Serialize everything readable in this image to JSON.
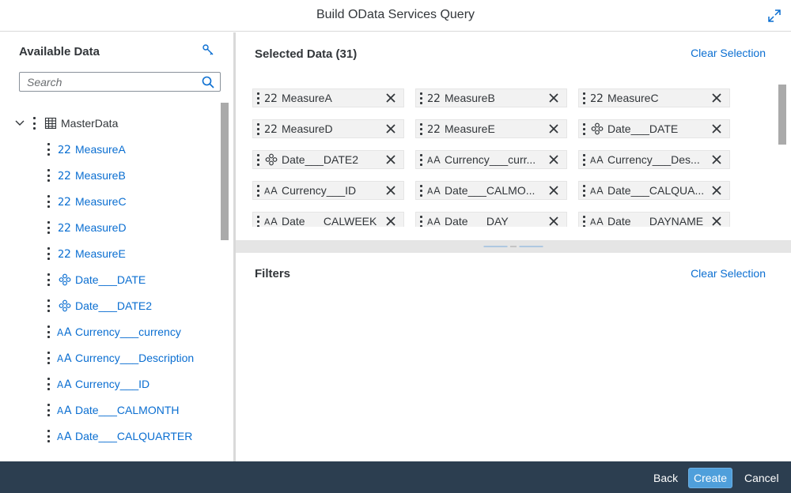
{
  "dialog": {
    "title": "Build OData Services Query"
  },
  "available": {
    "title": "Available Data",
    "search_placeholder": "Search",
    "root": {
      "label": "MasterData",
      "icon": "table-icon"
    },
    "items": [
      {
        "label": "MeasureA",
        "icon": "measure-icon"
      },
      {
        "label": "MeasureB",
        "icon": "measure-icon"
      },
      {
        "label": "MeasureC",
        "icon": "measure-icon"
      },
      {
        "label": "MeasureD",
        "icon": "measure-icon"
      },
      {
        "label": "MeasureE",
        "icon": "measure-icon"
      },
      {
        "label": "Date___DATE",
        "icon": "hierarchy-icon"
      },
      {
        "label": "Date___DATE2",
        "icon": "hierarchy-icon"
      },
      {
        "label": "Currency___currency",
        "icon": "text-dimension-icon"
      },
      {
        "label": "Currency___Description",
        "icon": "text-dimension-icon"
      },
      {
        "label": "Currency___ID",
        "icon": "text-dimension-icon"
      },
      {
        "label": "Date___CALMONTH",
        "icon": "text-dimension-icon"
      },
      {
        "label": "Date___CALQUARTER",
        "icon": "text-dimension-icon"
      }
    ]
  },
  "selected": {
    "title": "Selected Data (31)",
    "clear_label": "Clear Selection",
    "chips": [
      {
        "label": "MeasureA",
        "icon": "measure-icon"
      },
      {
        "label": "MeasureB",
        "icon": "measure-icon"
      },
      {
        "label": "MeasureC",
        "icon": "measure-icon"
      },
      {
        "label": "MeasureD",
        "icon": "measure-icon"
      },
      {
        "label": "MeasureE",
        "icon": "measure-icon"
      },
      {
        "label": "Date___DATE",
        "icon": "hierarchy-icon"
      },
      {
        "label": "Date___DATE2",
        "icon": "hierarchy-icon"
      },
      {
        "label": "Currency___curr...",
        "icon": "text-dimension-icon"
      },
      {
        "label": "Currency___Des...",
        "icon": "text-dimension-icon"
      },
      {
        "label": "Currency___ID",
        "icon": "text-dimension-icon"
      },
      {
        "label": "Date___CALMO...",
        "icon": "text-dimension-icon"
      },
      {
        "label": "Date___CALQUA...",
        "icon": "text-dimension-icon"
      },
      {
        "label": "Date___CALWEEK",
        "icon": "text-dimension-icon"
      },
      {
        "label": "Date___DAY",
        "icon": "text-dimension-icon"
      },
      {
        "label": "Date___DAYNAME",
        "icon": "text-dimension-icon"
      }
    ]
  },
  "filters": {
    "title": "Filters",
    "clear_label": "Clear Selection"
  },
  "footer": {
    "back_label": "Back",
    "create_label": "Create",
    "cancel_label": "Cancel"
  }
}
